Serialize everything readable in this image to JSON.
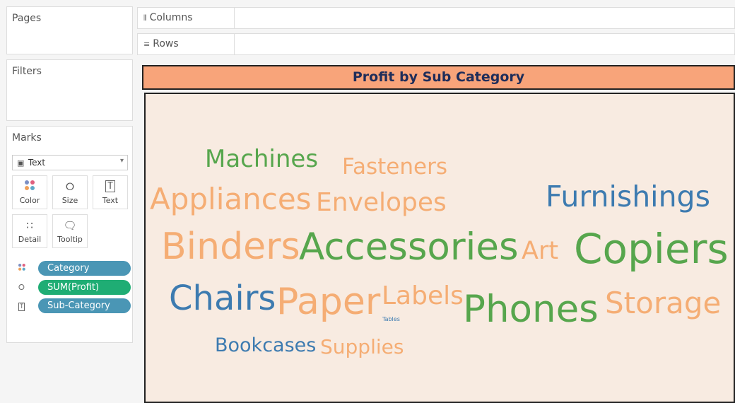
{
  "pages": {
    "title": "Pages"
  },
  "filters": {
    "title": "Filters"
  },
  "marks": {
    "title": "Marks",
    "mark_type": "Text",
    "buttons": {
      "color": "Color",
      "size": "Size",
      "text": "Text",
      "detail": "Detail",
      "tooltip": "Tooltip"
    },
    "pills": [
      {
        "label": "Category",
        "icon": "color-dots-icon",
        "color": "#4a96b5"
      },
      {
        "label": "SUM(Profit)",
        "icon": "size-icon",
        "color": "#1fad74"
      },
      {
        "label": "Sub-Category",
        "icon": "text-icon",
        "color": "#4a96b5"
      }
    ]
  },
  "shelves": {
    "columns": "Columns",
    "rows": "Rows"
  },
  "viz": {
    "title": "Profit by Sub Category",
    "colors": {
      "Furniture": "#3d7bb0",
      "Office Supplies": "#f5ad74",
      "Technology": "#57a64d",
      "title_bg": "#f8a47a",
      "canvas_bg": "#f8ebe1"
    },
    "words": [
      {
        "text": "Machines",
        "category": "Technology"
      },
      {
        "text": "Fasteners",
        "category": "Office Supplies"
      },
      {
        "text": "Appliances",
        "category": "Office Supplies"
      },
      {
        "text": "Envelopes",
        "category": "Office Supplies"
      },
      {
        "text": "Furnishings",
        "category": "Furniture"
      },
      {
        "text": "Binders",
        "category": "Office Supplies"
      },
      {
        "text": "Accessories",
        "category": "Technology"
      },
      {
        "text": "Art",
        "category": "Office Supplies"
      },
      {
        "text": "Copiers",
        "category": "Technology"
      },
      {
        "text": "Chairs",
        "category": "Furniture"
      },
      {
        "text": "Paper",
        "category": "Office Supplies"
      },
      {
        "text": "Labels",
        "category": "Office Supplies"
      },
      {
        "text": "Tables",
        "category": "Furniture"
      },
      {
        "text": "Phones",
        "category": "Technology"
      },
      {
        "text": "Storage",
        "category": "Office Supplies"
      },
      {
        "text": "Bookcases",
        "category": "Furniture"
      },
      {
        "text": "Supplies",
        "category": "Office Supplies"
      }
    ]
  }
}
